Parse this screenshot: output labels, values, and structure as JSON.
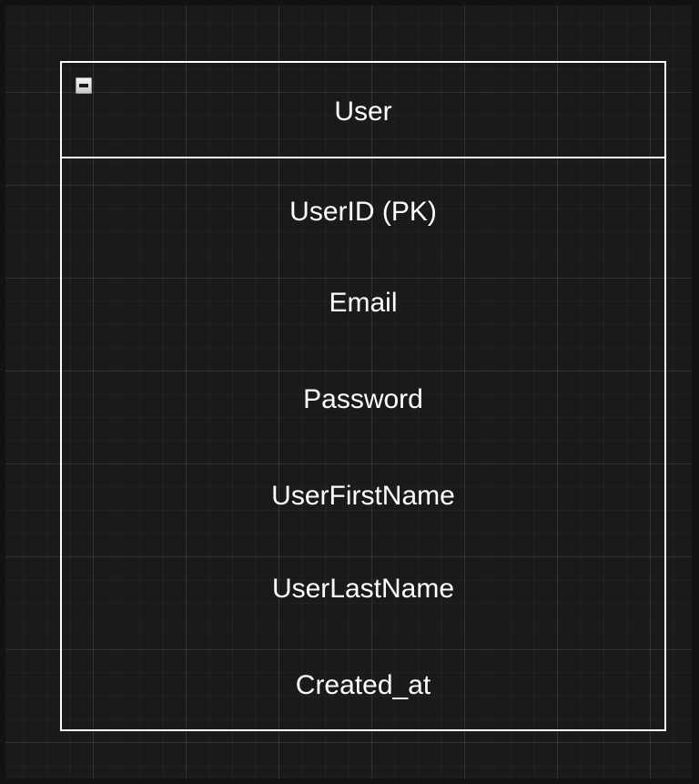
{
  "entity": {
    "title": "User",
    "attributes": [
      {
        "label": "UserID (PK)"
      },
      {
        "label": "Email"
      },
      {
        "label": "Password"
      },
      {
        "label": "UserFirstName"
      },
      {
        "label": "UserLastName"
      },
      {
        "label": "Created_at"
      }
    ]
  },
  "colors": {
    "background": "#1a1a1a",
    "stroke": "#ffffff",
    "text": "#ffffff"
  },
  "icons": {
    "collapse": "minus-collapse-icon"
  }
}
